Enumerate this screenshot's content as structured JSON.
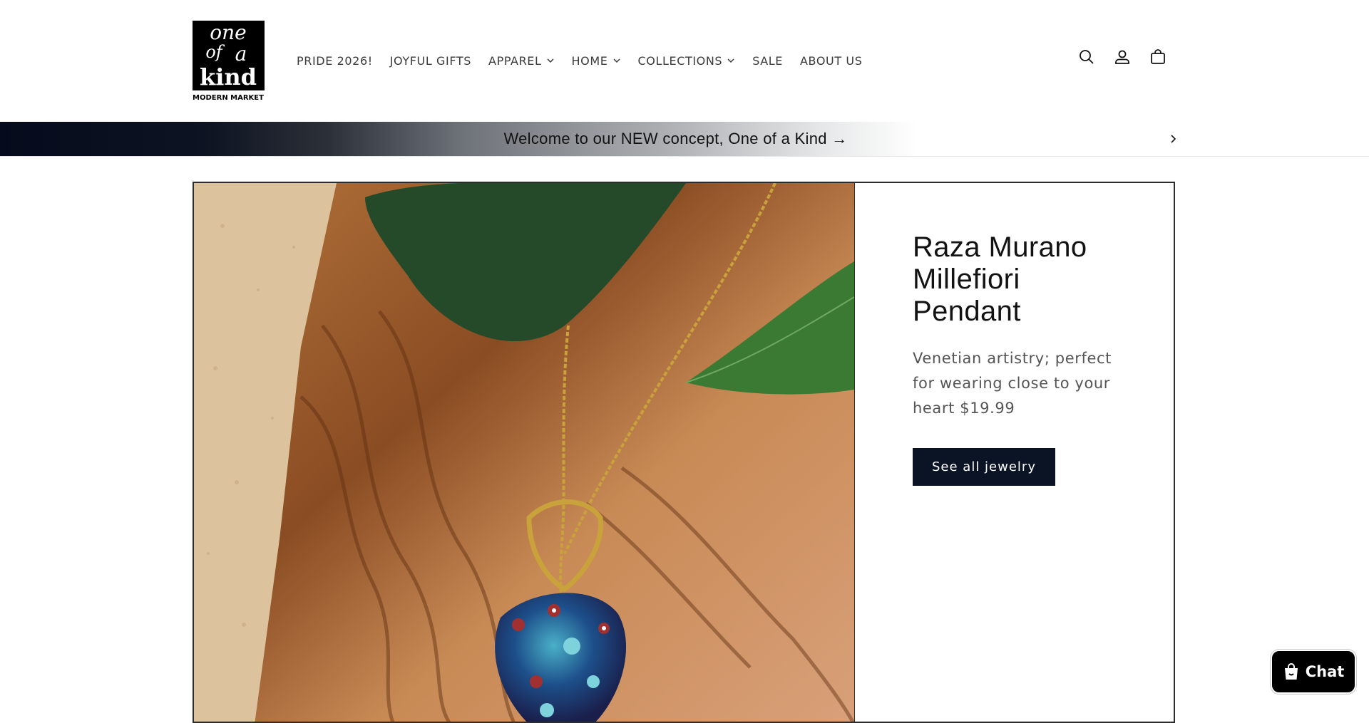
{
  "logo": {
    "lines": [
      "one",
      "of",
      "a",
      "kind"
    ],
    "tagline": "MODERN MARKET"
  },
  "nav": {
    "items": [
      {
        "label": "PRIDE 2026!",
        "dropdown": false
      },
      {
        "label": "JOYFUL GIFTS",
        "dropdown": false
      },
      {
        "label": "APPAREL",
        "dropdown": true
      },
      {
        "label": "HOME",
        "dropdown": true
      },
      {
        "label": "COLLECTIONS",
        "dropdown": true
      },
      {
        "label": "SALE",
        "dropdown": false
      },
      {
        "label": "ABOUT US",
        "dropdown": false
      }
    ]
  },
  "header_icons": [
    "search-icon",
    "account-icon",
    "cart-icon"
  ],
  "announcement": {
    "text": "Welcome to our NEW concept, One of a Kind →",
    "next_icon": "chevron-right-icon"
  },
  "feature": {
    "title": "Raza Murano Millefiori Pendant",
    "description": "Venetian artistry; perfect for wearing close to your heart $19.99",
    "button_label": "See all jewelry"
  },
  "chat": {
    "label": "Chat",
    "icon": "shopping-bag-icon"
  },
  "colors": {
    "button_bg": "#0b1424",
    "announcement_dark": "#050b1c",
    "text": "#121212"
  }
}
